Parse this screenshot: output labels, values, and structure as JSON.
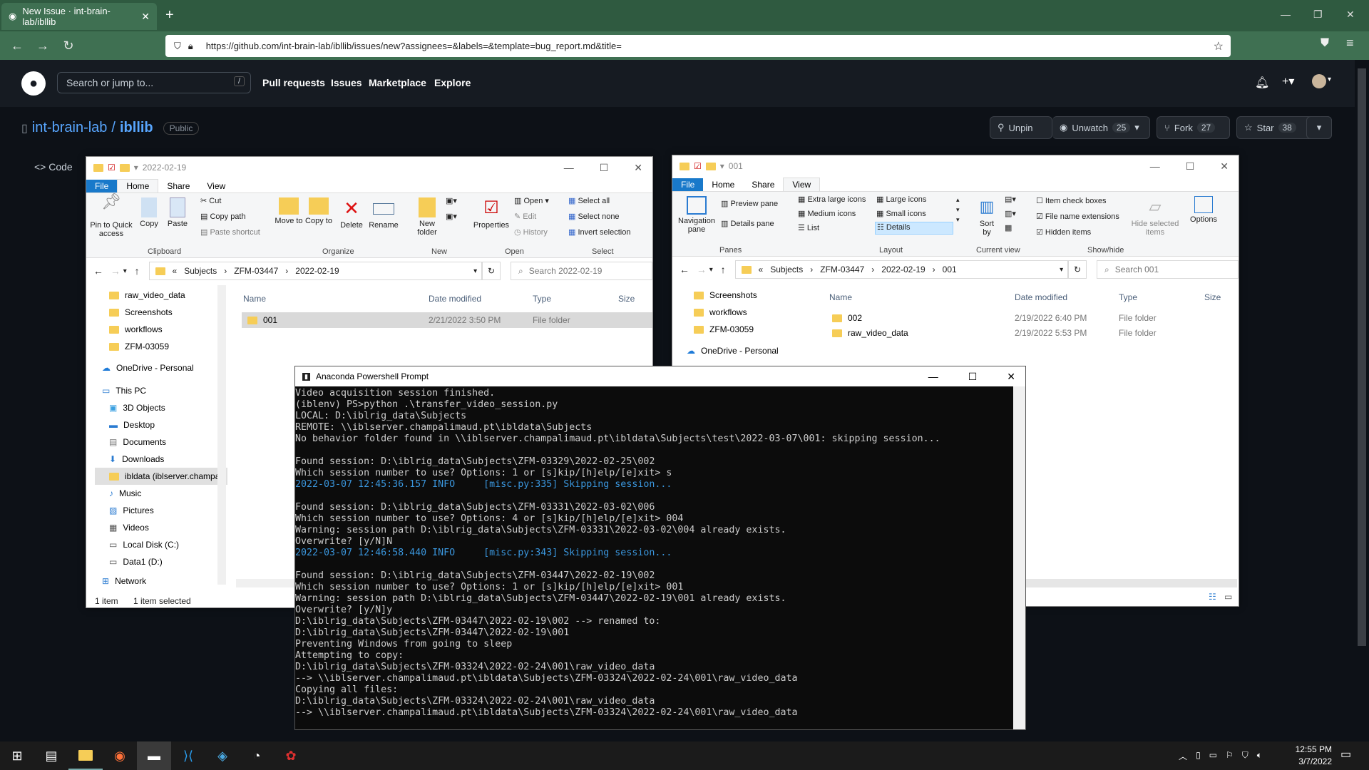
{
  "browser": {
    "tab_title": "New Issue · int-brain-lab/ibllib",
    "url": "https://github.com/int-brain-lab/ibllib/issues/new?assignees=&labels=&template=bug_report.md&title="
  },
  "github": {
    "search_placeholder": "Search or jump to...",
    "slash": "/",
    "nav": [
      "Pull requests",
      "Issues",
      "Marketplace",
      "Explore"
    ],
    "owner": "int-brain-lab",
    "sep": "/",
    "repo": "ibllib",
    "visibility": "Public",
    "unpin": "Unpin",
    "unwatch": "Unwatch",
    "watch_count": "25",
    "fork": "Fork",
    "fork_count": "27",
    "star": "Star",
    "star_count": "38",
    "code_tab": "Code"
  },
  "explorer1": {
    "title": "2022-02-19",
    "tabs": [
      "File",
      "Home",
      "Share",
      "View"
    ],
    "ribbon": {
      "pin": "Pin to Quick access",
      "copy": "Copy",
      "paste": "Paste",
      "cut": "Cut",
      "copy_path": "Copy path",
      "paste_shortcut": "Paste shortcut",
      "move_to": "Move to",
      "copy_to": "Copy to",
      "delete": "Delete",
      "rename": "Rename",
      "new_folder": "New folder",
      "properties": "Properties",
      "open": "Open",
      "edit": "Edit",
      "history": "History",
      "select_all": "Select all",
      "select_none": "Select none",
      "invert": "Invert selection",
      "groups": [
        "Clipboard",
        "Organize",
        "New",
        "Open",
        "Select"
      ]
    },
    "path": [
      "Subjects",
      "ZFM-03447",
      "2022-02-19"
    ],
    "search": "Search 2022-02-19",
    "nav": [
      "raw_video_data",
      "Screenshots",
      "workflows",
      "ZFM-03059",
      "OneDrive - Personal",
      "This PC",
      "3D Objects",
      "Desktop",
      "Documents",
      "Downloads",
      "ibldata (iblserver.champa",
      "Music",
      "Pictures",
      "Videos",
      "Local Disk (C:)",
      "Data1 (D:)",
      "Network"
    ],
    "cols": [
      "Name",
      "Date modified",
      "Type",
      "Size"
    ],
    "rows": [
      {
        "name": "001",
        "date": "2/21/2022 3:50 PM",
        "type": "File folder"
      }
    ],
    "status": [
      "1 item",
      "1 item selected"
    ]
  },
  "explorer2": {
    "title": "001",
    "tabs": [
      "File",
      "Home",
      "Share",
      "View"
    ],
    "ribbon": {
      "nav_pane": "Navigation pane",
      "preview": "Preview pane",
      "details_pane": "Details pane",
      "xl": "Extra large icons",
      "large": "Large icons",
      "medium": "Medium icons",
      "small": "Small icons",
      "list": "List",
      "details": "Details",
      "sort": "Sort by",
      "item_check": "Item check boxes",
      "ext": "File name extensions",
      "hidden": "Hidden items",
      "hide_sel": "Hide selected items",
      "options": "Options",
      "groups": [
        "Panes",
        "Layout",
        "Current view",
        "Show/hide"
      ]
    },
    "path": [
      "Subjects",
      "ZFM-03447",
      "2022-02-19",
      "001"
    ],
    "search": "Search 001",
    "nav": [
      "Screenshots",
      "workflows",
      "ZFM-03059",
      "OneDrive - Personal"
    ],
    "cols": [
      "Name",
      "Date modified",
      "Type",
      "Size"
    ],
    "rows": [
      {
        "name": "002",
        "date": "2/19/2022 6:40 PM",
        "type": "File folder"
      },
      {
        "name": "raw_video_data",
        "date": "2/19/2022 5:53 PM",
        "type": "File folder"
      }
    ]
  },
  "powershell": {
    "title": "Anaconda Powershell Prompt",
    "lines": [
      {
        "t": "Video acquisition session finished.",
        "c": ""
      },
      {
        "t": "(iblenv) PS>python .\\transfer_video_session.py",
        "c": ""
      },
      {
        "t": "LOCAL: D:\\iblrig_data\\Subjects",
        "c": ""
      },
      {
        "t": "REMOTE: \\\\iblserver.champalimaud.pt\\ibldata\\Subjects",
        "c": ""
      },
      {
        "t": "No behavior folder found in \\\\iblserver.champalimaud.pt\\ibldata\\Subjects\\test\\2022-03-07\\001: skipping session...",
        "c": ""
      },
      {
        "t": "",
        "c": ""
      },
      {
        "t": "Found session: D:\\iblrig_data\\Subjects\\ZFM-03329\\2022-02-25\\002",
        "c": ""
      },
      {
        "t": "Which session number to use? Options: 1 or [s]kip/[h]elp/[e]xit> s",
        "c": ""
      },
      {
        "t": "2022-03-07 12:45:36.157 INFO     [misc.py:335] Skipping session...",
        "c": "blue"
      },
      {
        "t": "",
        "c": ""
      },
      {
        "t": "Found session: D:\\iblrig_data\\Subjects\\ZFM-03331\\2022-03-02\\006",
        "c": ""
      },
      {
        "t": "Which session number to use? Options: 4 or [s]kip/[h]elp/[e]xit> 004",
        "c": ""
      },
      {
        "t": "Warning: session path D:\\iblrig_data\\Subjects\\ZFM-03331\\2022-03-02\\004 already exists.",
        "c": ""
      },
      {
        "t": "Overwrite? [y/N]N",
        "c": ""
      },
      {
        "t": "2022-03-07 12:46:58.440 INFO     [misc.py:343] Skipping session...",
        "c": "blue"
      },
      {
        "t": "",
        "c": ""
      },
      {
        "t": "Found session: D:\\iblrig_data\\Subjects\\ZFM-03447\\2022-02-19\\002",
        "c": ""
      },
      {
        "t": "Which session number to use? Options: 1 or [s]kip/[h]elp/[e]xit> 001",
        "c": ""
      },
      {
        "t": "Warning: session path D:\\iblrig_data\\Subjects\\ZFM-03447\\2022-02-19\\001 already exists.",
        "c": ""
      },
      {
        "t": "Overwrite? [y/N]y",
        "c": ""
      },
      {
        "t": "D:\\iblrig_data\\Subjects\\ZFM-03447\\2022-02-19\\002 --> renamed to:",
        "c": ""
      },
      {
        "t": "D:\\iblrig_data\\Subjects\\ZFM-03447\\2022-02-19\\001",
        "c": ""
      },
      {
        "t": "Preventing Windows from going to sleep",
        "c": ""
      },
      {
        "t": "Attempting to copy:",
        "c": ""
      },
      {
        "t": "D:\\iblrig_data\\Subjects\\ZFM-03324\\2022-02-24\\001\\raw_video_data",
        "c": ""
      },
      {
        "t": "--> \\\\iblserver.champalimaud.pt\\ibldata\\Subjects\\ZFM-03324\\2022-02-24\\001\\raw_video_data",
        "c": ""
      },
      {
        "t": "Copying all files:",
        "c": ""
      },
      {
        "t": "D:\\iblrig_data\\Subjects\\ZFM-03324\\2022-02-24\\001\\raw_video_data",
        "c": ""
      },
      {
        "t": "--> \\\\iblserver.champalimaud.pt\\ibldata\\Subjects\\ZFM-03324\\2022-02-24\\001\\raw_video_data",
        "c": ""
      }
    ]
  },
  "taskbar": {
    "time": "12:55 PM",
    "date": "3/7/2022"
  }
}
